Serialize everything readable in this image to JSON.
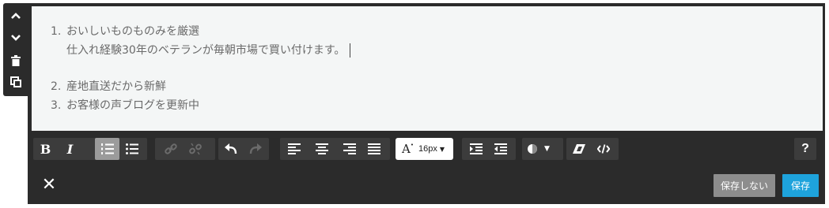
{
  "editor": {
    "list_items": [
      {
        "num": "1.",
        "text": "おいしいものものみを厳選",
        "continuation": "仕入れ経験30年のベテランが毎朝市場で買い付けます。"
      },
      {
        "num": "2.",
        "text": "産地直送だから新鮮"
      },
      {
        "num": "3.",
        "text": "お客様の声ブログを更新中"
      }
    ]
  },
  "toolbar": {
    "bold": "B",
    "italic": "I",
    "font_size_icon": "A",
    "font_size_value": "16px",
    "help": "?"
  },
  "footer": {
    "close": "✕",
    "discard_label": "保存しない",
    "save_label": "保存"
  },
  "colors": {
    "frame": "#2b2b2b",
    "content_bg": "#f4f6f6",
    "save_button": "#1ea3dc",
    "discard_button": "#8d8d8d",
    "active_tool": "#9b9b9b"
  },
  "icons": {
    "side": [
      "chevron-up-icon",
      "chevron-down-icon",
      "trash-icon",
      "duplicate-icon"
    ],
    "toolbar": [
      "ordered-list-icon",
      "unordered-list-icon",
      "link-icon",
      "unlink-icon",
      "undo-icon",
      "redo-icon",
      "align-left-icon",
      "align-center-icon",
      "align-right-icon",
      "align-justify-icon",
      "indent-icon",
      "outdent-icon",
      "color-icon",
      "eraser-icon",
      "code-icon"
    ]
  }
}
